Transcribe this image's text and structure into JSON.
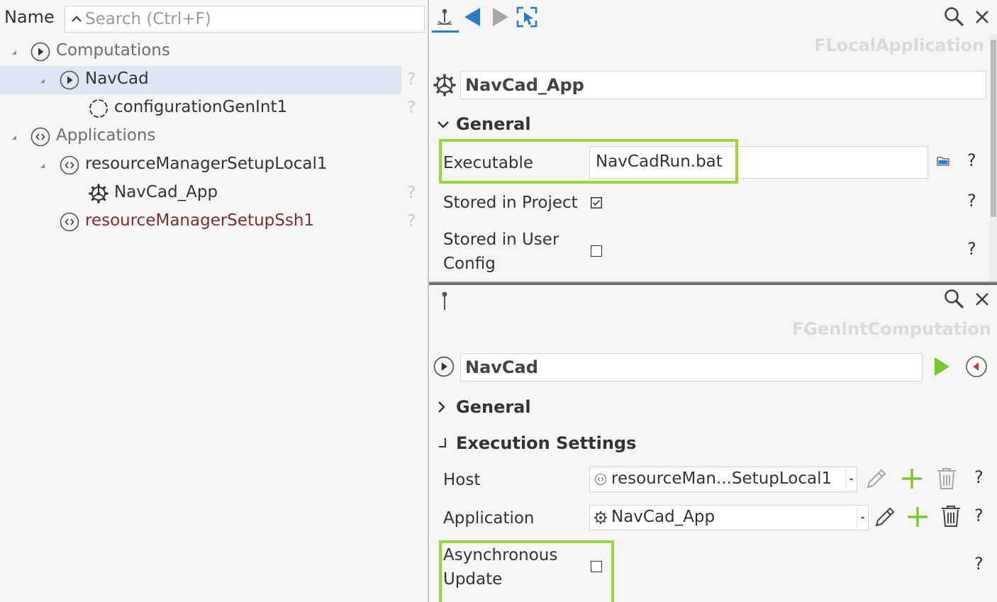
{
  "tree": {
    "header": "Name",
    "search_placeholder": "Search (Ctrl+F)",
    "help": "?",
    "nodes": [
      {
        "label": "Computations"
      },
      {
        "label": "NavCad"
      },
      {
        "label": "configurationGenInt1"
      },
      {
        "label": "Applications"
      },
      {
        "label": "resourceManagerSetupLocal1"
      },
      {
        "label": "NavCad_App"
      },
      {
        "label": "resourceManagerSetupSsh1"
      }
    ]
  },
  "top_panel": {
    "class_name": "FLocalApplication",
    "object_name": "NavCad_App",
    "section": "General",
    "properties": {
      "executable_label": "Executable",
      "executable_value": "NavCadRun.bat",
      "stored_in_project_label": "Stored in Project",
      "stored_in_project_checked": true,
      "stored_in_user_config_label_l1": "Stored in User",
      "stored_in_user_config_label_l2": "Config",
      "stored_in_user_config_checked": false
    },
    "help": "?"
  },
  "bottom_panel": {
    "class_name": "FGenIntComputation",
    "object_name": "NavCad",
    "section_general": "General",
    "section_execution": "Execution Settings",
    "host_label": "Host",
    "host_value": "resourceMan...SetupLocal1",
    "application_label": "Application",
    "application_value": "NavCad_App",
    "async_label_l1": "Asynchronous",
    "async_label_l2": "Update",
    "async_checked": false,
    "help": "?"
  },
  "colors": {
    "highlight": "#9cd63a",
    "selection": "#dce7f4",
    "nav_blue": "#2f79c9",
    "run_green": "#7bc62d",
    "stop_red": "#d9352b"
  }
}
